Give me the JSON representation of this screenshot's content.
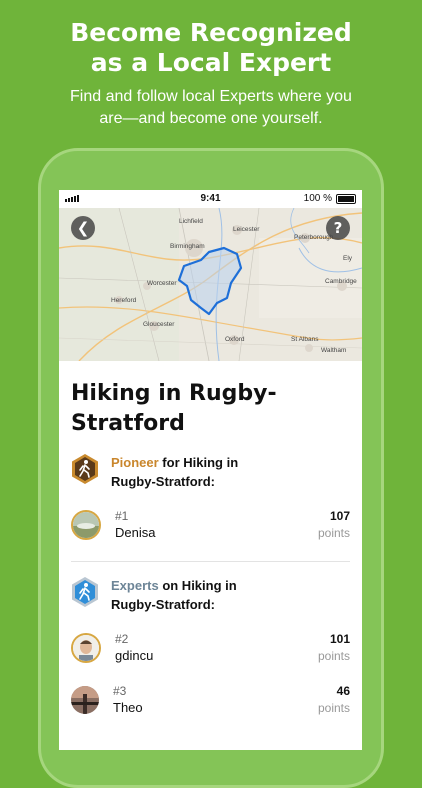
{
  "promo": {
    "headline_line1": "Become Recognized",
    "headline_line2": "as a Local Expert",
    "sub_line1": "Find and follow local Experts where you",
    "sub_line2": "are—and become one yourself."
  },
  "status": {
    "time": "9:41",
    "battery": "100 %"
  },
  "map": {
    "back_icon": "chevron-left-icon",
    "help_icon": "question-icon",
    "labels": [
      "Lichfield",
      "Leicester",
      "Birmingham",
      "Peterborough",
      "Ely",
      "Worcester",
      "Cambridge",
      "Hereford",
      "Gloucester",
      "Oxford",
      "St Albans",
      "Waltham"
    ],
    "route_color": "#1e6fd8"
  },
  "region": {
    "title_line1": "Hiking in Rugby-",
    "title_line2": "Stratford"
  },
  "pioneer": {
    "label": "Pioneer",
    "text_line1": " for Hiking in",
    "text_line2": "Rugby-Stratford:",
    "color": "#c9862c",
    "entries": [
      {
        "rank": "#1",
        "name": "Denisa",
        "points": "107",
        "points_label": "points"
      }
    ]
  },
  "experts": {
    "label": "Experts",
    "text_line1": " on Hiking in",
    "text_line2": "Rugby-Stratford:",
    "color": "#6d8597",
    "entries": [
      {
        "rank": "#2",
        "name": "gdincu",
        "points": "101",
        "points_label": "points"
      },
      {
        "rank": "#3",
        "name": "Theo",
        "points": "46",
        "points_label": "points"
      }
    ]
  }
}
